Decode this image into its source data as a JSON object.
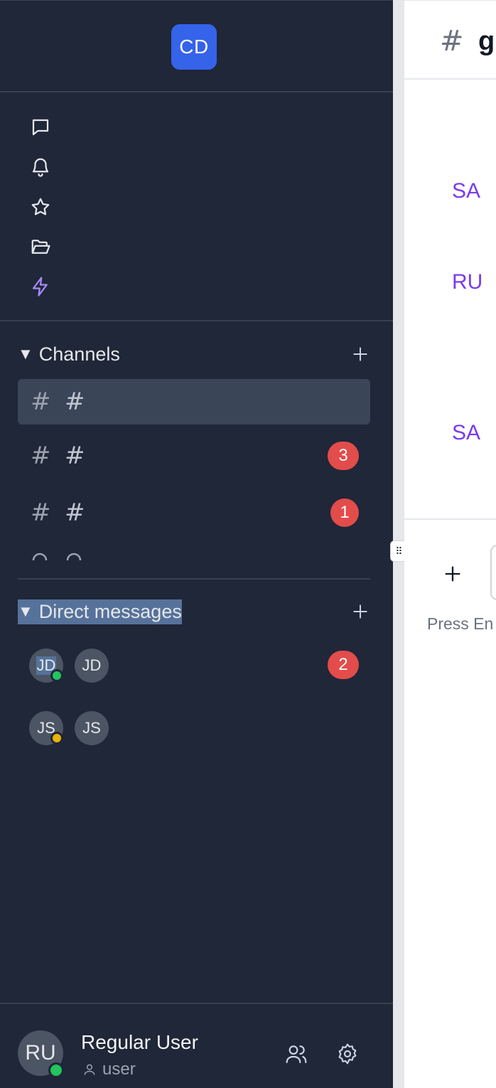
{
  "workspace": {
    "initials": "CD"
  },
  "nav": {
    "icons": [
      "message-icon",
      "bell-icon",
      "star-icon",
      "folder-icon",
      "lightning-icon"
    ],
    "accent_color": "#a78bfa"
  },
  "channels": {
    "title": "Channels",
    "toggle": "▼",
    "items": [
      {
        "prefix": "#",
        "name": "#",
        "badge": null,
        "active": true
      },
      {
        "prefix": "#",
        "name": "#",
        "badge": "3",
        "active": false
      },
      {
        "prefix": "#",
        "name": "#",
        "badge": "1",
        "active": false
      }
    ]
  },
  "direct_messages": {
    "title": "Direct messages",
    "toggle": "▼",
    "items": [
      {
        "avatar": "JD",
        "avatar2": "JD",
        "status": "online",
        "badge": "2"
      },
      {
        "avatar": "JS",
        "avatar2": "JS",
        "status": "away",
        "badge": null
      }
    ]
  },
  "current_user": {
    "initials": "RU",
    "name": "Regular User",
    "role": "user",
    "status": "online"
  },
  "main": {
    "channel_prefix": "#",
    "channel_title": "g",
    "message_initials": [
      "SA",
      "RU",
      "SA"
    ],
    "composer_hint": "Press En"
  },
  "colors": {
    "sidebar_bg": "#1f2738",
    "active_row": "#3a4557",
    "badge": "#e24c4b",
    "workspace_avatar": "#3563e9",
    "online": "#22c55e",
    "away": "#eab308",
    "message_initials": "#7c3aed"
  }
}
